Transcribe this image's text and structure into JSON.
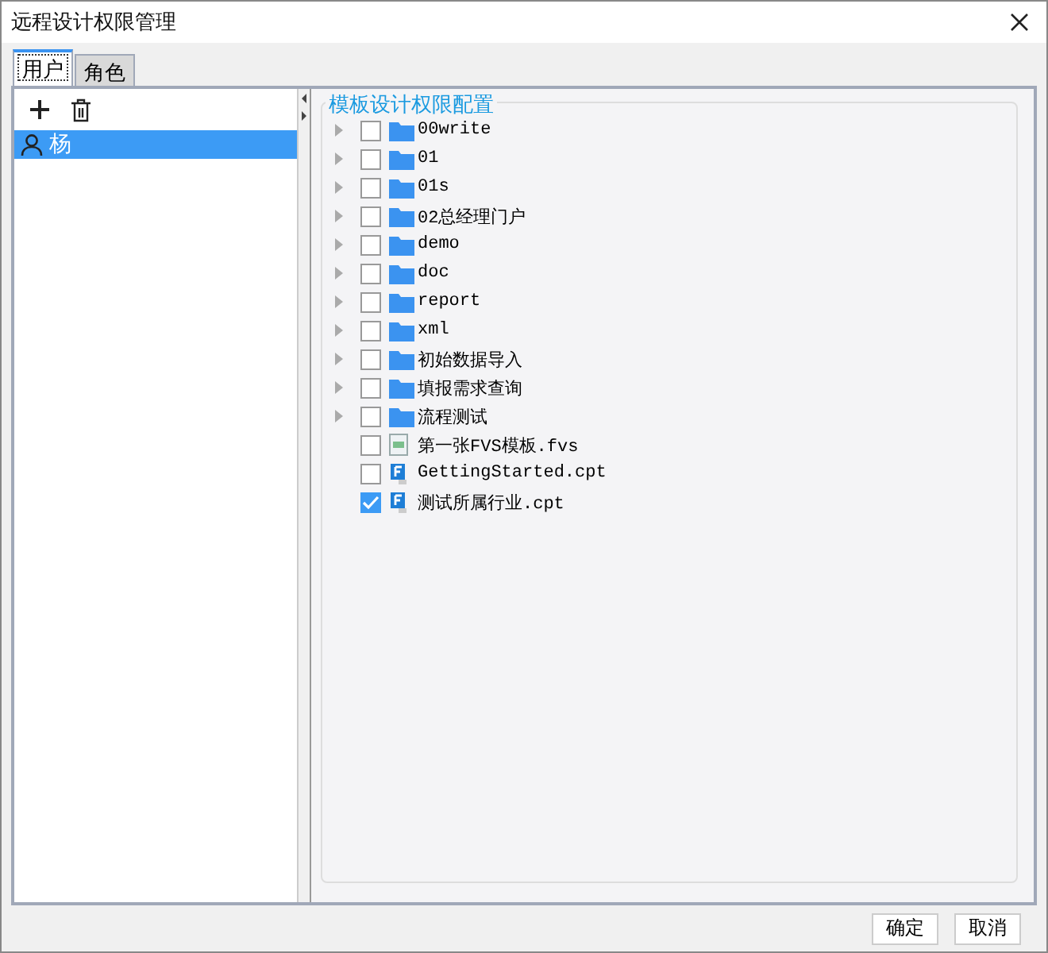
{
  "window": {
    "title": "远程设计权限管理"
  },
  "tabs": [
    {
      "label": "用户",
      "selected": true
    },
    {
      "label": "角色",
      "selected": false
    }
  ],
  "users": [
    {
      "name": "杨",
      "selected": true
    }
  ],
  "panel": {
    "title": "模板设计权限配置"
  },
  "tree": [
    {
      "label": "00write",
      "kind": "folder",
      "checked": false
    },
    {
      "label": "01",
      "kind": "folder",
      "checked": false
    },
    {
      "label": "01s",
      "kind": "folder",
      "checked": false
    },
    {
      "label": "02总经理门户",
      "kind": "folder",
      "checked": false
    },
    {
      "label": "demo",
      "kind": "folder",
      "checked": false
    },
    {
      "label": "doc",
      "kind": "folder",
      "checked": false
    },
    {
      "label": "report",
      "kind": "folder",
      "checked": false
    },
    {
      "label": "xml",
      "kind": "folder",
      "checked": false
    },
    {
      "label": "初始数据导入",
      "kind": "folder",
      "checked": false
    },
    {
      "label": "填报需求查询",
      "kind": "folder",
      "checked": false
    },
    {
      "label": "流程测试",
      "kind": "folder",
      "checked": false
    },
    {
      "label": "第一张FVS模板.fvs",
      "kind": "fvs",
      "checked": false
    },
    {
      "label": "GettingStarted.cpt",
      "kind": "cpt",
      "checked": false
    },
    {
      "label": "测试所属行业.cpt",
      "kind": "cpt",
      "checked": true
    }
  ],
  "buttons": [
    "确定",
    "取消"
  ]
}
